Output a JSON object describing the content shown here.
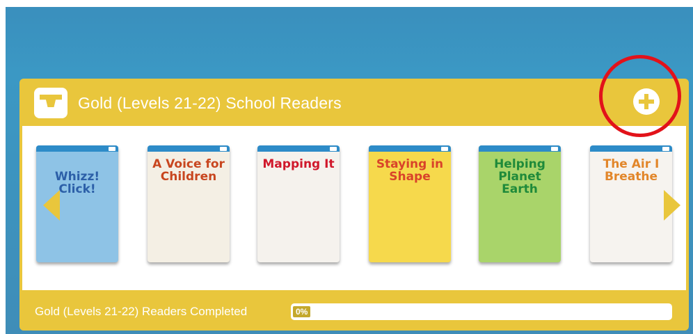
{
  "panel": {
    "title": "Gold (Levels 21-22) School Readers",
    "icon": "inbox-tray-icon",
    "add_icon": "plus-circle-icon"
  },
  "books": [
    {
      "title": "Whizz! Click!",
      "bg": "#8ec3e6",
      "title_color": "#2c5fa8"
    },
    {
      "title": "A Voice for Children",
      "bg": "#f4efe4",
      "title_color": "#c8461f"
    },
    {
      "title": "Mapping It",
      "bg": "#f5f2ed",
      "title_color": "#d0182b"
    },
    {
      "title": "Staying in Shape",
      "bg": "#f6d94c",
      "title_color": "#d9432a"
    },
    {
      "title": "Helping Planet Earth",
      "bg": "#a9d46a",
      "title_color": "#1f8a3a"
    },
    {
      "title": "The Air I Breathe",
      "bg": "#f6f3ef",
      "title_color": "#e2862a"
    }
  ],
  "footer": {
    "label": "Gold (Levels 21-22) Readers Completed",
    "progress_text": "0%",
    "progress_percent": 0
  },
  "colors": {
    "panel": "#e9c63c",
    "highlight": "#e2121a",
    "background": "#3b98c4"
  }
}
